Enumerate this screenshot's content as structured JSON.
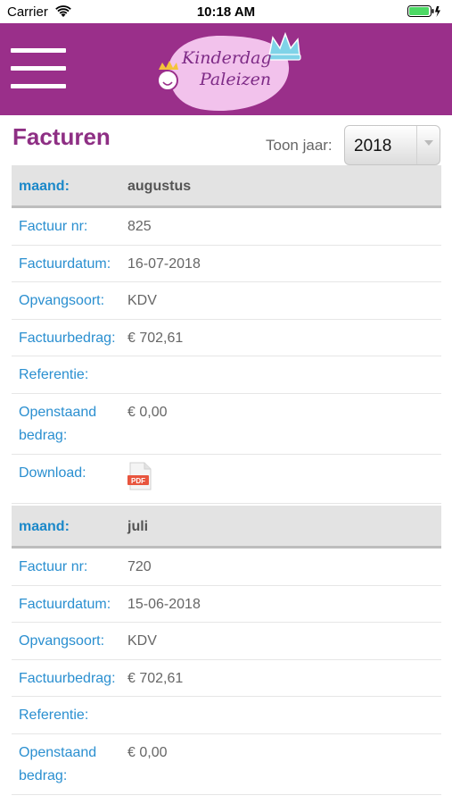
{
  "status_bar": {
    "carrier": "Carrier",
    "time": "10:18 AM",
    "wifi_icon": "wifi-icon",
    "battery_icon": "battery-icon",
    "battery_color": "#4cd964"
  },
  "header": {
    "background_color": "#9a2f8a",
    "menu_icon": "hamburger-menu-icon",
    "logo": {
      "line1": "Kinderdag",
      "line2": "Paleizen"
    }
  },
  "page": {
    "title": "Facturen",
    "year_filter": {
      "label": "Toon jaar:",
      "selected": "2018"
    }
  },
  "invoices": [
    {
      "month_label": "maand:",
      "month": "augustus",
      "fields": [
        {
          "label": "Factuur nr:",
          "value": "825"
        },
        {
          "label": "Factuurdatum:",
          "value": "16-07-2018"
        },
        {
          "label": "Opvangsoort:",
          "value": "KDV"
        },
        {
          "label": "Factuurbedrag:",
          "value": "€ 702,61"
        },
        {
          "label": "Referentie:",
          "value": ""
        },
        {
          "label": "Openstaand bedrag:",
          "value": "€ 0,00"
        }
      ],
      "download_label": "Download:",
      "download_icon": "pdf-icon",
      "pdf_text": "PDF"
    },
    {
      "month_label": "maand:",
      "month": "juli",
      "fields": [
        {
          "label": "Factuur nr:",
          "value": "720"
        },
        {
          "label": "Factuurdatum:",
          "value": "15-06-2018"
        },
        {
          "label": "Opvangsoort:",
          "value": "KDV"
        },
        {
          "label": "Factuurbedrag:",
          "value": "€ 702,61"
        },
        {
          "label": "Referentie:",
          "value": ""
        },
        {
          "label": "Openstaand bedrag:",
          "value": "€ 0,00"
        }
      ]
    }
  ]
}
